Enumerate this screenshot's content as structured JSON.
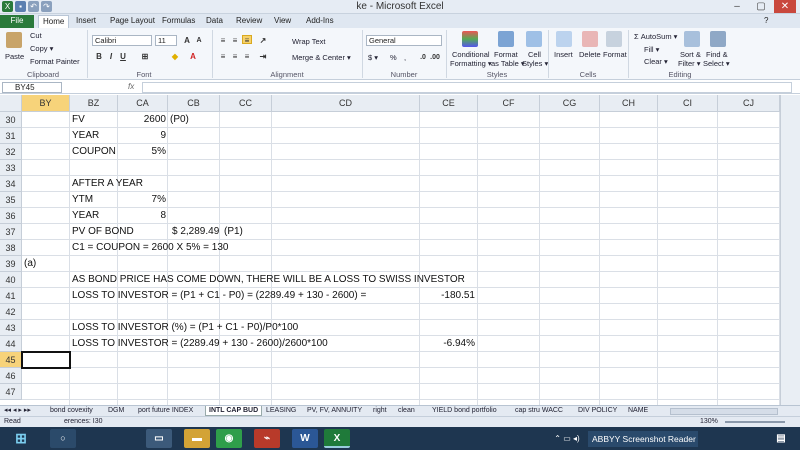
{
  "window": {
    "title": "ke  -  Microsoft Excel"
  },
  "ribbon_tabs": [
    "File",
    "Home",
    "Insert",
    "Page Layout",
    "Formulas",
    "Data",
    "Review",
    "View",
    "Add-Ins"
  ],
  "ribbon": {
    "clipboard": {
      "paste": "Paste",
      "cut": "Cut",
      "copy": "Copy ▾",
      "format_painter": "Format Painter",
      "label": "Clipboard"
    },
    "font": {
      "name": "Calibri",
      "size": "11",
      "bold": "B",
      "italic": "I",
      "underline": "U",
      "label": "Font"
    },
    "alignment": {
      "wrap": "Wrap Text",
      "merge": "Merge & Center ▾",
      "label": "Alignment"
    },
    "number": {
      "format": "General",
      "currency": "$ ▾",
      "percent": "%",
      "comma": ",",
      "label": "Number"
    },
    "styles": {
      "conditional": "Conditional",
      "conditional2": "Formatting ▾",
      "format_table": "Format",
      "format_table2": "as Table ▾",
      "cell_styles": "Cell",
      "cell_styles2": "Styles ▾",
      "label": "Styles"
    },
    "cells": {
      "insert": "Insert",
      "delete": "Delete",
      "format": "Format",
      "label": "Cells"
    },
    "editing": {
      "autosum": "Σ AutoSum ▾",
      "fill": "Fill ▾",
      "clear": "Clear ▾",
      "sort": "Sort &",
      "sort2": "Filter ▾",
      "find": "Find &",
      "find2": "Select ▾",
      "label": "Editing"
    }
  },
  "formula_bar": {
    "name_box": "BY45",
    "fx": "fx",
    "value": ""
  },
  "columns": [
    "BY",
    "BZ",
    "CA",
    "CB",
    "CC",
    "CD",
    "CE",
    "CF",
    "CG",
    "CH",
    "CI",
    "CJ"
  ],
  "rows": [
    "30",
    "31",
    "32",
    "33",
    "34",
    "35",
    "36",
    "37",
    "38",
    "39",
    "40",
    "41",
    "42",
    "43",
    "44",
    "45",
    "46",
    "47"
  ],
  "selected": {
    "column": "BY",
    "row": "45"
  },
  "cells": {
    "r30_bz": "FV",
    "r30_ca": "2600",
    "r30_cb": "(P0)",
    "r31_bz": "YEAR",
    "r31_ca": "9",
    "r32_bz": "COUPON",
    "r32_ca": "5%",
    "r34_bz": "AFTER A YEAR",
    "r35_bz": "YTM",
    "r35_ca": "7%",
    "r36_bz": "YEAR",
    "r36_ca": "8",
    "r37_bz": "PV OF BOND",
    "r37_cb": "$ 2,289.49",
    "r37_cb2": "(P1)",
    "r38_bz": "C1 = COUPON = 2600 X 5% = 130",
    "r39_by": "(a)",
    "r40_bz": "AS BOND PRICE HAS COME DOWN, THERE WILL BE A LOSS TO SWISS INVESTOR",
    "r41_bz": "LOSS TO INVESTOR = (P1 + C1 - P0) = (2289.49 + 130 - 2600) =",
    "r41_ce": "-180.51",
    "r43_bz": "LOSS TO INVESTOR (%) = (P1 + C1 - P0)/P0*100",
    "r44_bz": "LOSS TO INVESTOR = (2289.49 + 130 - 2600)/2600*100",
    "r44_ce": "-6.94%"
  },
  "sheet_tabs": [
    "bond covexity",
    "DGM",
    "port future INDEX",
    "INTL CAP BUD",
    "LEASING",
    "PV, FV, ANNUITY",
    "right",
    "clean",
    "YIELD bond portfolio",
    "cap stru WACC",
    "DIV POLICY",
    "NAME"
  ],
  "active_sheet": "INTL CAP BUD",
  "status": {
    "left": "Read",
    "refs": "erences: I30",
    "zoom": "130%"
  },
  "taskbar": {
    "app_label": "ABBYY Screenshot Reader"
  },
  "colors": {
    "file_tab": "#2a7a3b",
    "selected_header": "#f7d37a",
    "taskbar": "#1e3650"
  }
}
